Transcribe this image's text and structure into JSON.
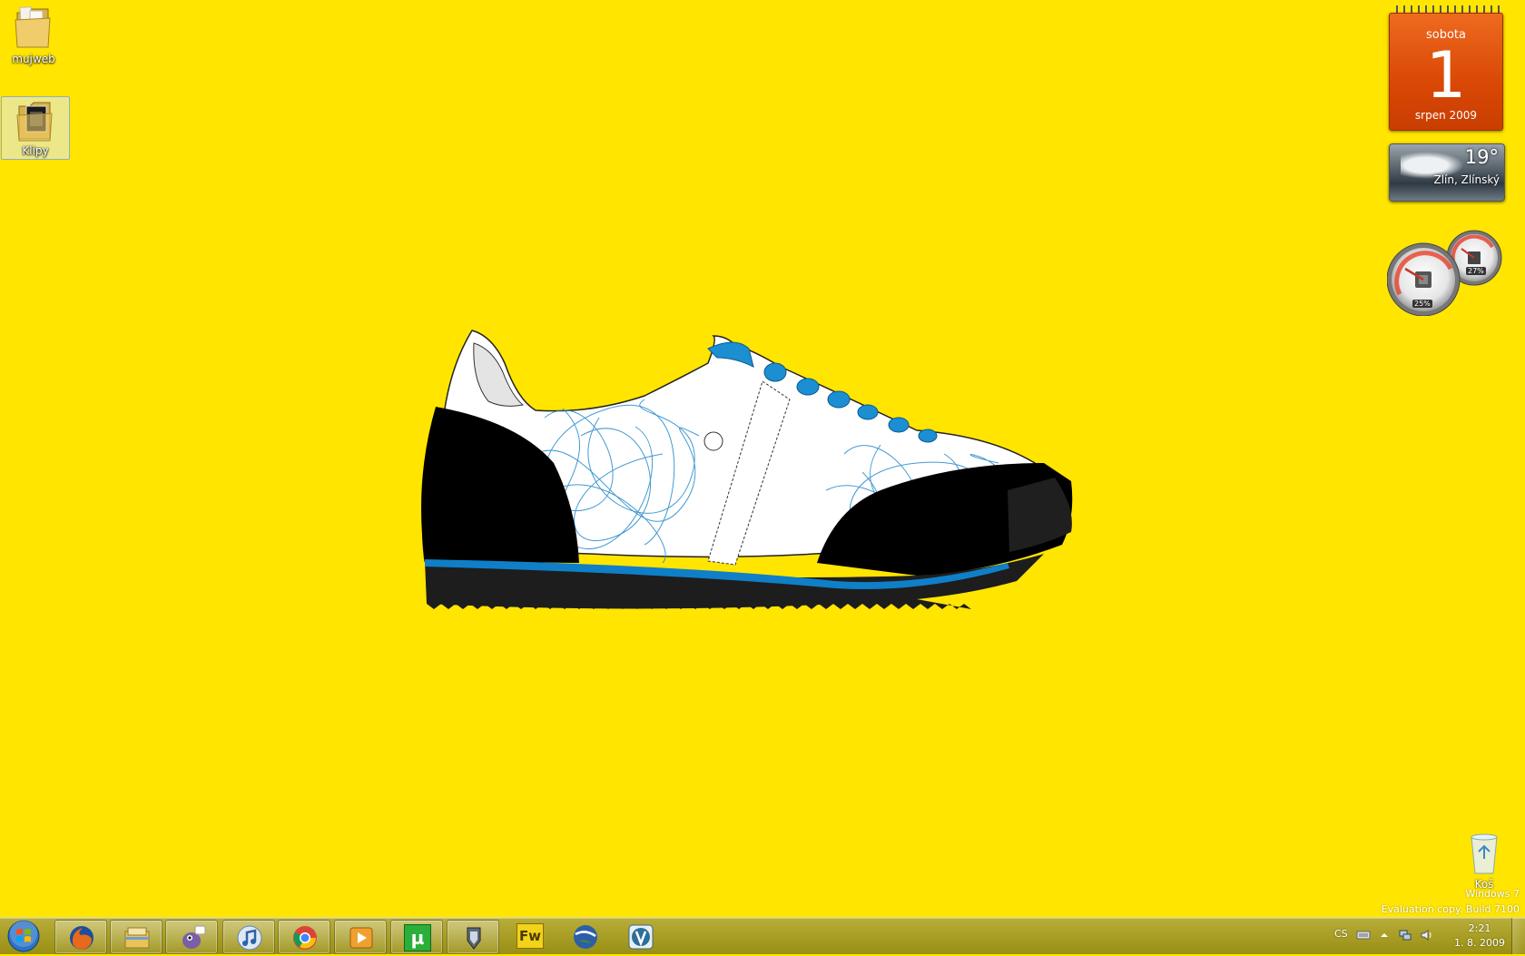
{
  "desktop": {
    "background_color": "#FFE500",
    "icons": [
      {
        "label": "mujweb"
      },
      {
        "label": "Klipy"
      }
    ],
    "recycle_bin": {
      "label": "Koš"
    }
  },
  "gadgets": {
    "calendar": {
      "day_name": "sobota",
      "day": "1",
      "month_year": "srpen 2009"
    },
    "weather": {
      "temperature": "19°",
      "location": "Zlín, Zlínský"
    },
    "cpu_meter": {
      "cpu": "25%",
      "memory": "27%"
    }
  },
  "watermark": {
    "line1": "Windows 7",
    "line2": "Evaluation copy. Build 7100"
  },
  "taskbar": {
    "pinned": [
      {
        "name": "firefox-icon"
      },
      {
        "name": "explorer-icon"
      },
      {
        "name": "pidgin-icon"
      },
      {
        "name": "itunes-icon"
      },
      {
        "name": "chrome-icon"
      },
      {
        "name": "media-player-icon"
      },
      {
        "name": "utorrent-icon"
      },
      {
        "name": "app-icon"
      },
      {
        "name": "fireworks-icon"
      },
      {
        "name": "google-earth-icon"
      },
      {
        "name": "dvd-app-icon"
      }
    ],
    "fireworks_label": "Fw",
    "utorrent_label": "µ",
    "tray": {
      "language": "CS",
      "time": "2:21",
      "date": "1. 8. 2009"
    }
  }
}
